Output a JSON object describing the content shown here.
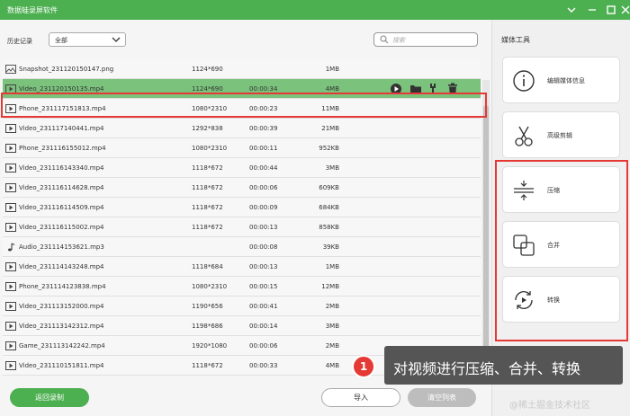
{
  "window": {
    "title": "数据蛙录屏软件"
  },
  "toolbar": {
    "history_label": "历史记录",
    "filter_value": "全部",
    "search_placeholder": "搜索"
  },
  "files": [
    {
      "name": "Snapshot_231120150147.png",
      "type": "image",
      "resolution": "1124*690",
      "duration": "",
      "size": "1MB"
    },
    {
      "name": "Video_231120150135.mp4",
      "type": "video",
      "resolution": "1124*690",
      "duration": "00:00:34",
      "size": "4MB",
      "selected": true
    },
    {
      "name": "Phone_231117151813.mp4",
      "type": "video",
      "resolution": "1080*2310",
      "duration": "00:00:23",
      "size": "11MB"
    },
    {
      "name": "Video_231117140441.mp4",
      "type": "video",
      "resolution": "1292*838",
      "duration": "00:00:39",
      "size": "21MB"
    },
    {
      "name": "Phone_231116155012.mp4",
      "type": "video",
      "resolution": "1080*2310",
      "duration": "00:00:11",
      "size": "952KB"
    },
    {
      "name": "Video_231116143340.mp4",
      "type": "video",
      "resolution": "1118*672",
      "duration": "00:00:44",
      "size": "3MB"
    },
    {
      "name": "Video_231116114628.mp4",
      "type": "video",
      "resolution": "1118*672",
      "duration": "00:00:06",
      "size": "609KB"
    },
    {
      "name": "Video_231116114509.mp4",
      "type": "video",
      "resolution": "1118*672",
      "duration": "00:00:09",
      "size": "684KB"
    },
    {
      "name": "Video_231116115002.mp4",
      "type": "video",
      "resolution": "1118*672",
      "duration": "00:00:13",
      "size": "858KB"
    },
    {
      "name": "Audio_231114153621.mp3",
      "type": "audio",
      "resolution": "",
      "duration": "00:00:08",
      "size": "39KB"
    },
    {
      "name": "Video_231114143248.mp4",
      "type": "video",
      "resolution": "1118*684",
      "duration": "00:00:13",
      "size": "1MB"
    },
    {
      "name": "Phone_231114123838.mp4",
      "type": "video",
      "resolution": "1080*2310",
      "duration": "00:00:15",
      "size": "12MB"
    },
    {
      "name": "Video_231113152000.mp4",
      "type": "video",
      "resolution": "1190*656",
      "duration": "00:00:41",
      "size": "2MB"
    },
    {
      "name": "Video_231113142312.mp4",
      "type": "video",
      "resolution": "1198*686",
      "duration": "00:00:14",
      "size": "3MB"
    },
    {
      "name": "Game_231113142242.mp4",
      "type": "video",
      "resolution": "1920*1080",
      "duration": "00:00:06",
      "size": "2MB"
    },
    {
      "name": "Video_231110151811.mp4",
      "type": "video",
      "resolution": "1118*672",
      "duration": "00:00:33",
      "size": "4MB"
    }
  ],
  "buttons": {
    "back": "返回录制",
    "import": "导入",
    "clear": "清空列表"
  },
  "media_tools": {
    "title": "媒体工具",
    "items": [
      {
        "label": "编辑媒体信息",
        "icon": "info-icon"
      },
      {
        "label": "高级剪辑",
        "icon": "scissors-icon"
      },
      {
        "label": "压缩",
        "icon": "compress-icon"
      },
      {
        "label": "合并",
        "icon": "merge-icon"
      },
      {
        "label": "转换",
        "icon": "convert-icon"
      }
    ]
  },
  "callout": {
    "badge": "1",
    "text": "对视频进行压缩、合并、转换"
  },
  "watermark": "@稀土掘金技术社区",
  "colors": {
    "accent": "#4caf50",
    "selected_row": "#7bc27d",
    "highlight": "#e53935"
  }
}
